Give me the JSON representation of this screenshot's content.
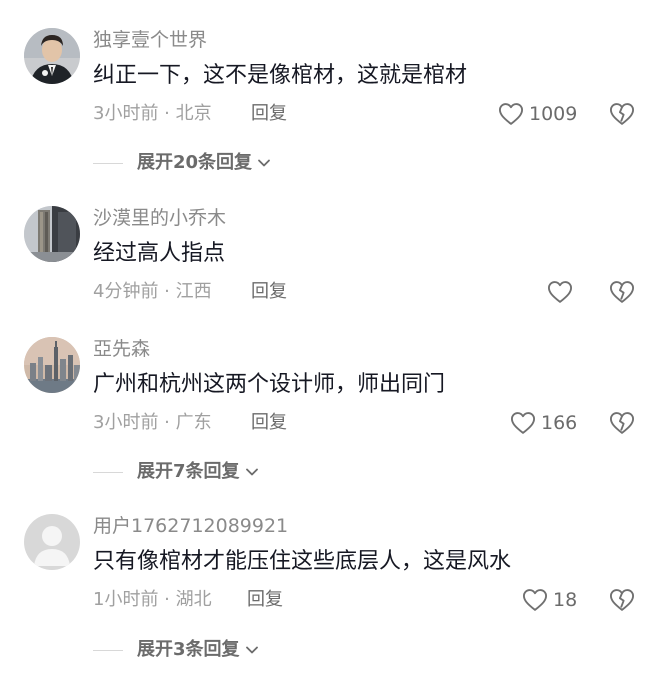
{
  "comments": [
    {
      "username": "独享壹个世界",
      "content": "纠正一下，这不是像棺材，这就是棺材",
      "meta": "3小时前 · 北京",
      "reply_label": "回复",
      "likes": "1009",
      "expand_label": "展开20条回复",
      "avatar": "avatar-man-suit"
    },
    {
      "username": "沙漠里的小乔木",
      "content": "经过高人指点",
      "meta": "4分钟前 · 江西",
      "reply_label": "回复",
      "likes": "",
      "avatar": "avatar-building"
    },
    {
      "username": "亞先森",
      "content": "广州和杭州这两个设计师，师出同门",
      "meta": "3小时前 · 广东",
      "reply_label": "回复",
      "likes": "166",
      "expand_label": "展开7条回复",
      "avatar": "avatar-city-skyline"
    },
    {
      "username": "用户1762712089921",
      "content": "只有像棺材才能压住这些底层人，这是风水",
      "meta": "1小时前 · 湖北",
      "reply_label": "回复",
      "likes": "18",
      "expand_label": "展开3条回复",
      "avatar": "avatar-default"
    }
  ],
  "icons": {
    "like": "heart-outline-icon",
    "dislike": "broken-heart-icon",
    "expand": "chevron-down-icon"
  },
  "colors": {
    "username": "#8a8a8a",
    "content": "#161823",
    "meta": "#a0a0a0",
    "action": "#6b6b6b"
  }
}
